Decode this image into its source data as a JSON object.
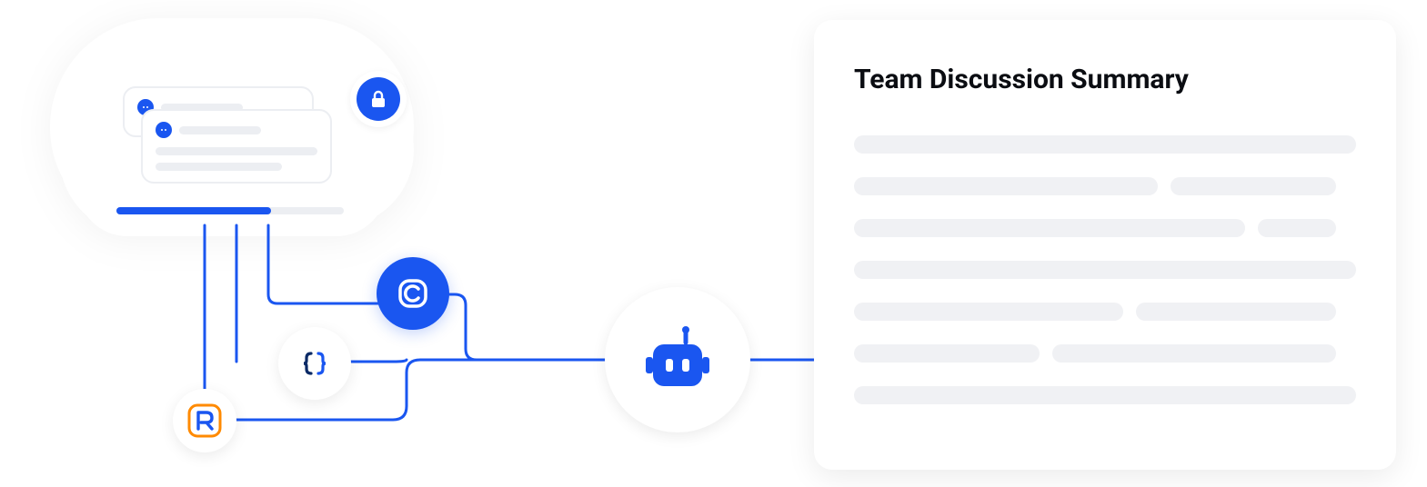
{
  "summary": {
    "title": "Team Discussion Summary"
  },
  "icons": {
    "lock": "lock-icon",
    "c_logo": "c-logo-icon",
    "brackets_logo": "code-brackets-icon",
    "r_logo": "r-letter-icon",
    "robot": "robot-icon"
  },
  "colors": {
    "primary": "#1a56f0",
    "accent_orange": "#ff8a00",
    "skeleton": "#f0f1f4",
    "line_gray": "#eceef2"
  },
  "progress": {
    "percent": 68
  }
}
